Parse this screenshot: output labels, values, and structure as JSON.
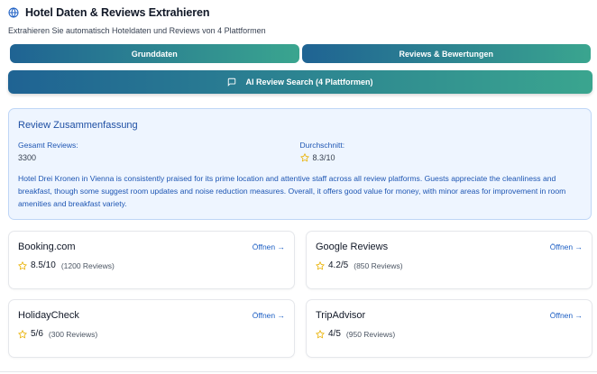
{
  "header": {
    "title": "Hotel Daten & Reviews Extrahieren",
    "subtitle": "Extrahieren Sie automatisch Hoteldaten und Reviews von 4 Plattformen"
  },
  "tabs": [
    {
      "label": "Grunddaten"
    },
    {
      "label": "Reviews & Bewertungen"
    }
  ],
  "ai_button": {
    "label": "AI Review Search (4 Plattformen)"
  },
  "summary": {
    "title": "Review Zusammenfassung",
    "total_label": "Gesamt Reviews:",
    "total_value": "3300",
    "avg_label": "Durchschnitt:",
    "avg_value": "8.3/10",
    "text": "Hotel Drei Kronen in Vienna is consistently praised for its prime location and attentive staff across all review platforms. Guests appreciate the cleanliness and breakfast, though some suggest room updates and noise reduction measures. Overall, it offers good value for money, with minor areas for improvement in room amenities and breakfast variety."
  },
  "platforms": [
    {
      "name": "Booking.com",
      "rating": "8.5/10",
      "count": "(1200 Reviews)",
      "link": "Öffnen →"
    },
    {
      "name": "Google Reviews",
      "rating": "4.2/5",
      "count": "(850 Reviews)",
      "link": "Öffnen →"
    },
    {
      "name": "HolidayCheck",
      "rating": "5/6",
      "count": "(300 Reviews)",
      "link": "Öffnen →"
    },
    {
      "name": "TripAdvisor",
      "rating": "4/5",
      "count": "(950 Reviews)",
      "link": "Öffnen →"
    }
  ],
  "colors": {
    "accent_start": "#1f6393",
    "accent_end": "#3aa58f",
    "star": "#eab308",
    "link": "#1d5fc4"
  }
}
